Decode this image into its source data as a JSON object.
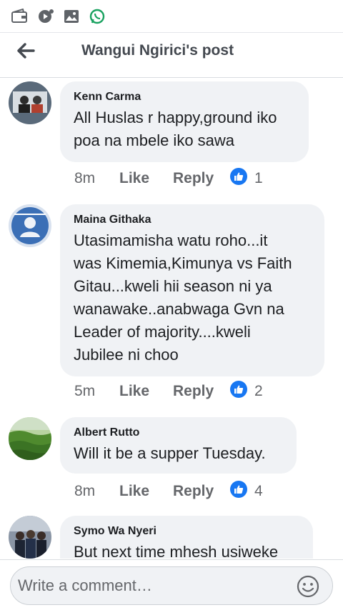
{
  "status_bar": {
    "icons": [
      "wallet-icon",
      "media-icon",
      "gallery-icon",
      "whatsapp-icon"
    ]
  },
  "header": {
    "title": "Wangui Ngirici's post",
    "back_icon": "back-arrow-icon"
  },
  "actions": {
    "like_label": "Like",
    "reply_label": "Reply"
  },
  "comments": [
    {
      "author": "Kenn Carma",
      "text": "All Huslas r happy,ground iko\npoa na mbele iko sawa",
      "time": "8m",
      "reactions": "1"
    },
    {
      "author": "Maina Githaka",
      "text": "Utasimamisha watu roho...it\nwas Kimemia,Kimunya vs Faith\nGitau...kweli hii season ni ya\nwanawake..anabwaga Gvn na\nLeader of majority....kweli\nJubilee ni choo",
      "time": "5m",
      "reactions": "2"
    },
    {
      "author": "Albert Rutto",
      "text": "Will it be a supper Tuesday.",
      "time": "8m",
      "reactions": "4"
    },
    {
      "author": "Symo Wa Nyeri",
      "text": "But next time mhesh usiweke",
      "time": "",
      "reactions": ""
    }
  ],
  "composer": {
    "placeholder": "Write a comment…",
    "emoji_icon": "smiley-icon"
  },
  "colors": {
    "like_blue": "#1877f2",
    "bubble_bg": "#f0f2f5",
    "meta_gray": "#65676b",
    "whatsapp_green": "#25d366"
  }
}
